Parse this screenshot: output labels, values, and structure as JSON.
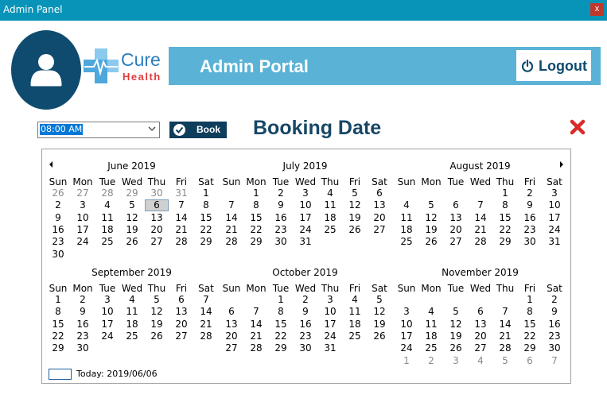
{
  "window": {
    "title": "Admin Panel",
    "close_label": "x"
  },
  "header": {
    "logo_word1": "Cure",
    "logo_word2": "Health",
    "portal_title": "Admin Portal",
    "logout_label": "Logout"
  },
  "booking": {
    "time_value": "08:00 AM",
    "book_label": "Book",
    "heading": "Booking Date"
  },
  "calendar": {
    "weekdays": [
      "Sun",
      "Mon",
      "Tue",
      "Wed",
      "Thu",
      "Fri",
      "Sat"
    ],
    "today_label": "Today: 2019/06/06",
    "months": [
      {
        "title": "June 2019",
        "weeks": [
          [
            [
              "26",
              1
            ],
            [
              "27",
              1
            ],
            [
              "28",
              1
            ],
            [
              "29",
              1
            ],
            [
              "30",
              1
            ],
            [
              "31",
              1
            ],
            [
              "1",
              0
            ]
          ],
          [
            [
              "2",
              0
            ],
            [
              "3",
              0
            ],
            [
              "4",
              0
            ],
            [
              "5",
              0
            ],
            [
              "6",
              2
            ],
            [
              "7",
              0
            ],
            [
              "8",
              0
            ]
          ],
          [
            [
              "9",
              0
            ],
            [
              "10",
              0
            ],
            [
              "11",
              0
            ],
            [
              "12",
              0
            ],
            [
              "13",
              0
            ],
            [
              "14",
              0
            ],
            [
              "15",
              0
            ]
          ],
          [
            [
              "16",
              0
            ],
            [
              "17",
              0
            ],
            [
              "18",
              0
            ],
            [
              "19",
              0
            ],
            [
              "20",
              0
            ],
            [
              "21",
              0
            ],
            [
              "22",
              0
            ]
          ],
          [
            [
              "23",
              0
            ],
            [
              "24",
              0
            ],
            [
              "25",
              0
            ],
            [
              "26",
              0
            ],
            [
              "27",
              0
            ],
            [
              "28",
              0
            ],
            [
              "29",
              0
            ]
          ],
          [
            [
              "30",
              0
            ]
          ]
        ]
      },
      {
        "title": "July 2019",
        "weeks": [
          [
            [
              "",
              0
            ],
            [
              "1",
              0
            ],
            [
              "2",
              0
            ],
            [
              "3",
              0
            ],
            [
              "4",
              0
            ],
            [
              "5",
              0
            ],
            [
              "6",
              0
            ]
          ],
          [
            [
              "7",
              0
            ],
            [
              "8",
              0
            ],
            [
              "9",
              0
            ],
            [
              "10",
              0
            ],
            [
              "11",
              0
            ],
            [
              "12",
              0
            ],
            [
              "13",
              0
            ]
          ],
          [
            [
              "14",
              0
            ],
            [
              "15",
              0
            ],
            [
              "16",
              0
            ],
            [
              "17",
              0
            ],
            [
              "18",
              0
            ],
            [
              "19",
              0
            ],
            [
              "20",
              0
            ]
          ],
          [
            [
              "21",
              0
            ],
            [
              "22",
              0
            ],
            [
              "23",
              0
            ],
            [
              "24",
              0
            ],
            [
              "25",
              0
            ],
            [
              "26",
              0
            ],
            [
              "27",
              0
            ]
          ],
          [
            [
              "28",
              0
            ],
            [
              "29",
              0
            ],
            [
              "30",
              0
            ],
            [
              "31",
              0
            ]
          ]
        ]
      },
      {
        "title": "August 2019",
        "weeks": [
          [
            [
              "",
              0
            ],
            [
              "",
              0
            ],
            [
              "",
              0
            ],
            [
              "",
              0
            ],
            [
              "1",
              0
            ],
            [
              "2",
              0
            ],
            [
              "3",
              0
            ]
          ],
          [
            [
              "4",
              0
            ],
            [
              "5",
              0
            ],
            [
              "6",
              0
            ],
            [
              "7",
              0
            ],
            [
              "8",
              0
            ],
            [
              "9",
              0
            ],
            [
              "10",
              0
            ]
          ],
          [
            [
              "11",
              0
            ],
            [
              "12",
              0
            ],
            [
              "13",
              0
            ],
            [
              "14",
              0
            ],
            [
              "15",
              0
            ],
            [
              "16",
              0
            ],
            [
              "17",
              0
            ]
          ],
          [
            [
              "18",
              0
            ],
            [
              "19",
              0
            ],
            [
              "20",
              0
            ],
            [
              "21",
              0
            ],
            [
              "22",
              0
            ],
            [
              "23",
              0
            ],
            [
              "24",
              0
            ]
          ],
          [
            [
              "25",
              0
            ],
            [
              "26",
              0
            ],
            [
              "27",
              0
            ],
            [
              "28",
              0
            ],
            [
              "29",
              0
            ],
            [
              "30",
              0
            ],
            [
              "31",
              0
            ]
          ]
        ]
      },
      {
        "title": "September 2019",
        "weeks": [
          [
            [
              "1",
              0
            ],
            [
              "2",
              0
            ],
            [
              "3",
              0
            ],
            [
              "4",
              0
            ],
            [
              "5",
              0
            ],
            [
              "6",
              0
            ],
            [
              "7",
              0
            ]
          ],
          [
            [
              "8",
              0
            ],
            [
              "9",
              0
            ],
            [
              "10",
              0
            ],
            [
              "11",
              0
            ],
            [
              "12",
              0
            ],
            [
              "13",
              0
            ],
            [
              "14",
              0
            ]
          ],
          [
            [
              "15",
              0
            ],
            [
              "16",
              0
            ],
            [
              "17",
              0
            ],
            [
              "18",
              0
            ],
            [
              "19",
              0
            ],
            [
              "20",
              0
            ],
            [
              "21",
              0
            ]
          ],
          [
            [
              "22",
              0
            ],
            [
              "23",
              0
            ],
            [
              "24",
              0
            ],
            [
              "25",
              0
            ],
            [
              "26",
              0
            ],
            [
              "27",
              0
            ],
            [
              "28",
              0
            ]
          ],
          [
            [
              "29",
              0
            ],
            [
              "30",
              0
            ]
          ]
        ]
      },
      {
        "title": "October 2019",
        "weeks": [
          [
            [
              "",
              0
            ],
            [
              "",
              0
            ],
            [
              "1",
              0
            ],
            [
              "2",
              0
            ],
            [
              "3",
              0
            ],
            [
              "4",
              0
            ],
            [
              "5",
              0
            ]
          ],
          [
            [
              "6",
              0
            ],
            [
              "7",
              0
            ],
            [
              "8",
              0
            ],
            [
              "9",
              0
            ],
            [
              "10",
              0
            ],
            [
              "11",
              0
            ],
            [
              "12",
              0
            ]
          ],
          [
            [
              "13",
              0
            ],
            [
              "14",
              0
            ],
            [
              "15",
              0
            ],
            [
              "16",
              0
            ],
            [
              "17",
              0
            ],
            [
              "18",
              0
            ],
            [
              "19",
              0
            ]
          ],
          [
            [
              "20",
              0
            ],
            [
              "21",
              0
            ],
            [
              "22",
              0
            ],
            [
              "23",
              0
            ],
            [
              "24",
              0
            ],
            [
              "25",
              0
            ],
            [
              "26",
              0
            ]
          ],
          [
            [
              "27",
              0
            ],
            [
              "28",
              0
            ],
            [
              "29",
              0
            ],
            [
              "30",
              0
            ],
            [
              "31",
              0
            ]
          ]
        ]
      },
      {
        "title": "November 2019",
        "weeks": [
          [
            [
              "",
              0
            ],
            [
              "",
              0
            ],
            [
              "",
              0
            ],
            [
              "",
              0
            ],
            [
              "",
              0
            ],
            [
              "1",
              0
            ],
            [
              "2",
              0
            ]
          ],
          [
            [
              "3",
              0
            ],
            [
              "4",
              0
            ],
            [
              "5",
              0
            ],
            [
              "6",
              0
            ],
            [
              "7",
              0
            ],
            [
              "8",
              0
            ],
            [
              "9",
              0
            ]
          ],
          [
            [
              "10",
              0
            ],
            [
              "11",
              0
            ],
            [
              "12",
              0
            ],
            [
              "13",
              0
            ],
            [
              "14",
              0
            ],
            [
              "15",
              0
            ],
            [
              "16",
              0
            ]
          ],
          [
            [
              "17",
              0
            ],
            [
              "18",
              0
            ],
            [
              "19",
              0
            ],
            [
              "20",
              0
            ],
            [
              "21",
              0
            ],
            [
              "22",
              0
            ],
            [
              "23",
              0
            ]
          ],
          [
            [
              "24",
              0
            ],
            [
              "25",
              0
            ],
            [
              "26",
              0
            ],
            [
              "27",
              0
            ],
            [
              "28",
              0
            ],
            [
              "29",
              0
            ],
            [
              "30",
              0
            ]
          ],
          [
            [
              "1",
              1
            ],
            [
              "2",
              1
            ],
            [
              "3",
              1
            ],
            [
              "4",
              1
            ],
            [
              "5",
              1
            ],
            [
              "6",
              1
            ],
            [
              "7",
              1
            ]
          ]
        ]
      }
    ]
  },
  "colors": {
    "titlebar": "#0894b8",
    "portal_bar": "#5ab3d6",
    "dark_navy": "#0f3d5c",
    "heading": "#174766",
    "close_red": "#d92b2b"
  },
  "icons": {
    "avatar": "user-icon",
    "logout": "power-icon",
    "book": "check-circle-icon",
    "close": "red-x-icon",
    "dropdown": "chevron-down-icon"
  }
}
